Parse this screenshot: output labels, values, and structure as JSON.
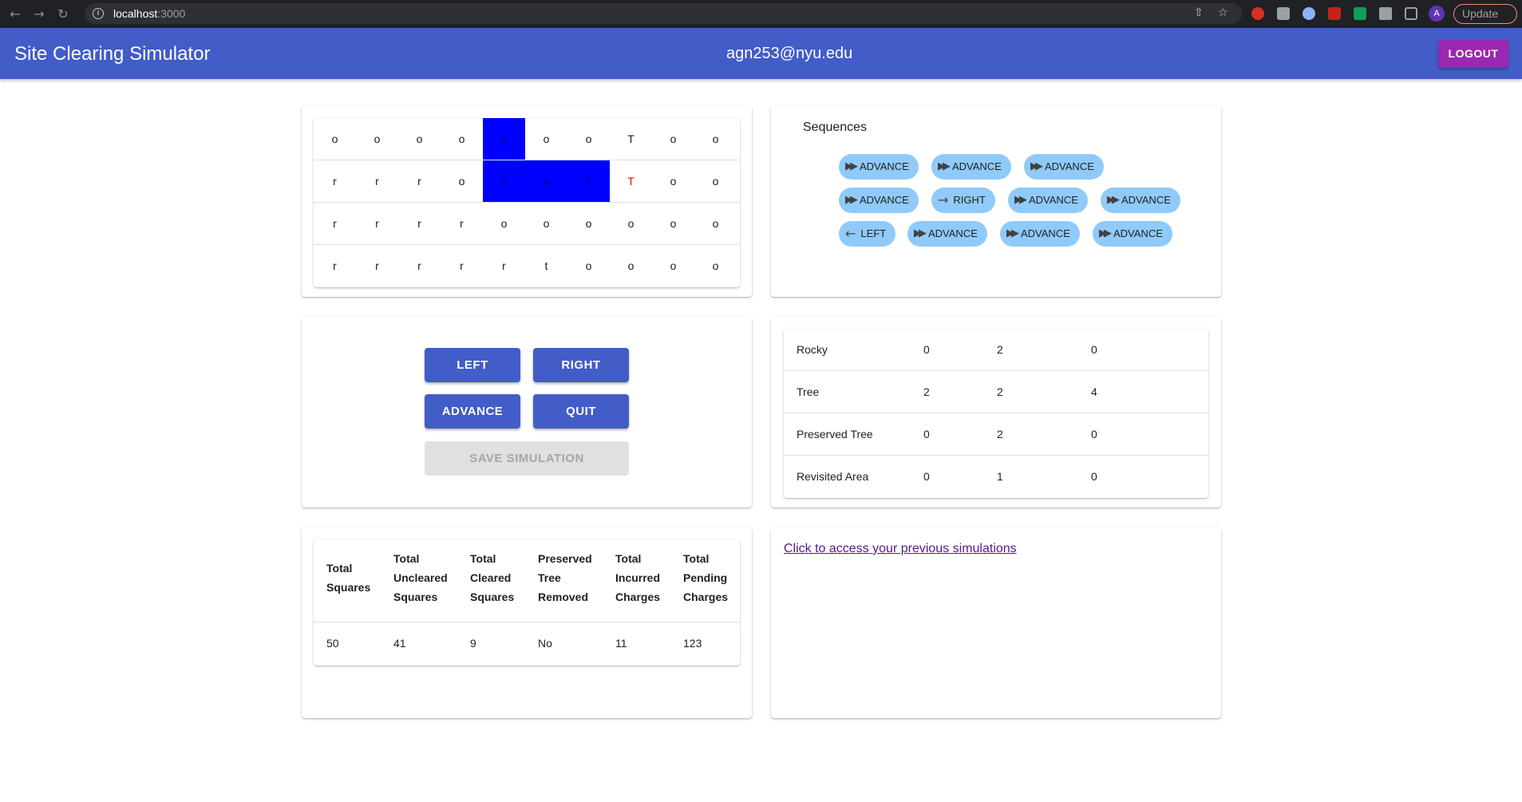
{
  "browser": {
    "url_host": "localhost",
    "url_port": ":3000",
    "profile_initial": "A",
    "update_label": "Update"
  },
  "header": {
    "title": "Site Clearing Simulator",
    "user": "agn253@nyu.edu",
    "logout_label": "LOGOUT"
  },
  "grid": [
    [
      {
        "v": "o",
        "s": ""
      },
      {
        "v": "o",
        "s": ""
      },
      {
        "v": "o",
        "s": ""
      },
      {
        "v": "o",
        "s": ""
      },
      {
        "v": "o",
        "s": "cleared"
      },
      {
        "v": "o",
        "s": ""
      },
      {
        "v": "o",
        "s": ""
      },
      {
        "v": "T",
        "s": ""
      },
      {
        "v": "o",
        "s": ""
      },
      {
        "v": "o",
        "s": ""
      }
    ],
    [
      {
        "v": "r",
        "s": ""
      },
      {
        "v": "r",
        "s": ""
      },
      {
        "v": "r",
        "s": ""
      },
      {
        "v": "o",
        "s": ""
      },
      {
        "v": "o",
        "s": "cleared"
      },
      {
        "v": "o",
        "s": "cleared"
      },
      {
        "v": "t",
        "s": "cleared"
      },
      {
        "v": "T",
        "s": "red"
      },
      {
        "v": "o",
        "s": ""
      },
      {
        "v": "o",
        "s": ""
      }
    ],
    [
      {
        "v": "r",
        "s": ""
      },
      {
        "v": "r",
        "s": ""
      },
      {
        "v": "r",
        "s": ""
      },
      {
        "v": "r",
        "s": ""
      },
      {
        "v": "o",
        "s": ""
      },
      {
        "v": "o",
        "s": ""
      },
      {
        "v": "o",
        "s": ""
      },
      {
        "v": "o",
        "s": ""
      },
      {
        "v": "o",
        "s": ""
      },
      {
        "v": "o",
        "s": ""
      }
    ],
    [
      {
        "v": "r",
        "s": ""
      },
      {
        "v": "r",
        "s": ""
      },
      {
        "v": "r",
        "s": ""
      },
      {
        "v": "r",
        "s": ""
      },
      {
        "v": "r",
        "s": ""
      },
      {
        "v": "t",
        "s": ""
      },
      {
        "v": "o",
        "s": ""
      },
      {
        "v": "o",
        "s": ""
      },
      {
        "v": "o",
        "s": ""
      },
      {
        "v": "o",
        "s": ""
      }
    ]
  ],
  "sequences": {
    "title": "Sequences",
    "chips": [
      {
        "label": "ADVANCE",
        "icon": "fast-forward-icon"
      },
      {
        "label": "ADVANCE",
        "icon": "fast-forward-icon"
      },
      {
        "label": "ADVANCE",
        "icon": "fast-forward-icon"
      },
      {
        "label": "ADVANCE",
        "icon": "fast-forward-icon"
      },
      {
        "label": "RIGHT",
        "icon": "arrow-right-icon"
      },
      {
        "label": "ADVANCE",
        "icon": "fast-forward-icon"
      },
      {
        "label": "ADVANCE",
        "icon": "fast-forward-icon"
      },
      {
        "label": "LEFT",
        "icon": "arrow-left-icon"
      },
      {
        "label": "ADVANCE",
        "icon": "fast-forward-icon"
      },
      {
        "label": "ADVANCE",
        "icon": "fast-forward-icon"
      },
      {
        "label": "ADVANCE",
        "icon": "fast-forward-icon"
      }
    ]
  },
  "controls": {
    "left": "LEFT",
    "right": "RIGHT",
    "advance": "ADVANCE",
    "quit": "QUIT",
    "save": "SAVE SIMULATION"
  },
  "stats": [
    [
      "Rocky",
      "0",
      "2",
      "0"
    ],
    [
      "Tree",
      "2",
      "2",
      "4"
    ],
    [
      "Preserved Tree",
      "0",
      "2",
      "0"
    ],
    [
      "Revisited Area",
      "0",
      "1",
      "0"
    ]
  ],
  "summary": {
    "headers": [
      [
        "Total",
        "Squares"
      ],
      [
        "Total",
        "Uncleared",
        "Squares"
      ],
      [
        "Total",
        "Cleared",
        "Squares"
      ],
      [
        "Preserved",
        "Tree",
        "Removed"
      ],
      [
        "Total",
        "Incurred",
        "Charges"
      ],
      [
        "Total",
        "Pending",
        "Charges"
      ]
    ],
    "values": [
      "50",
      "41",
      "9",
      "No",
      "11",
      "123"
    ]
  },
  "previous_link": "Click to access your previous simulations",
  "colors": {
    "app_bar": "#425cc8",
    "logout": "#9c27b0",
    "chip": "#90caf9",
    "cleared_cell": "#0000ff"
  }
}
